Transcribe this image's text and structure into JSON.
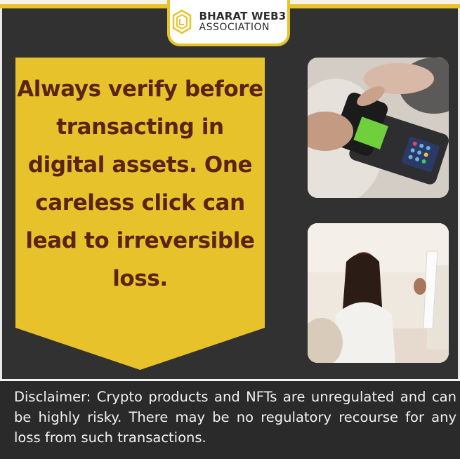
{
  "brand": {
    "line1": "BHARAT WEB3",
    "line2": "ASSOCIATION"
  },
  "headline": "Always verify before transacting in digital assets. One careless click can lead to irreversible loss.",
  "disclaimer": "Disclaimer: Crypto products and NFTs are unregulated and can be highly risky. There may be no regulatory recourse for any loss from such transactions.",
  "colors": {
    "background": "#313131",
    "accent_yellow": "#e8c22a",
    "headline_text": "#5a2414"
  },
  "images": {
    "top": "hand tapping phone on card payment terminal",
    "bottom": "woman looking at long paper receipt"
  }
}
